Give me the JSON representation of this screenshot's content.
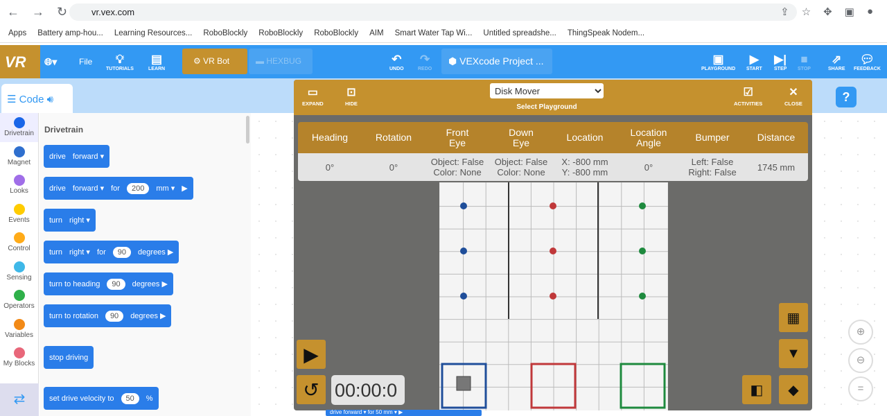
{
  "browser": {
    "url": "vr.vex.com",
    "bookmarks": [
      "Apps",
      "Battery amp-hou...",
      "Learning Resources...",
      "RoboBlockly",
      "RoboBlockly",
      "RoboBlockly",
      "AIM",
      "Smart Water Tap Wi...",
      "Untitled spreadshe...",
      "ThingSpeak Nodem..."
    ]
  },
  "toolbar": {
    "logo": "VR",
    "file": "File",
    "tutorials": "TUTORIALS",
    "learn": "LEARN",
    "vr_bot": "VR Bot",
    "hexbug": "HEXBUG",
    "undo": "UNDO",
    "redo": "REDO",
    "project": "VEXcode Project ...",
    "playground": "PLAYGROUND",
    "start": "START",
    "step": "STEP",
    "stop": "STOP",
    "share": "SHARE",
    "feedback": "FEEDBACK"
  },
  "code_tab": "Code",
  "categories": [
    {
      "label": "Drivetrain",
      "color": "#1a66e8"
    },
    {
      "label": "Magnet",
      "color": "#2f6fce"
    },
    {
      "label": "Looks",
      "color": "#a06ee8"
    },
    {
      "label": "Events",
      "color": "#ffcc00"
    },
    {
      "label": "Control",
      "color": "#ffab19"
    },
    {
      "label": "Sensing",
      "color": "#3fb8e8"
    },
    {
      "label": "Operators",
      "color": "#2fb04a"
    },
    {
      "label": "Variables",
      "color": "#f28a17"
    },
    {
      "label": "My Blocks",
      "color": "#e8677a"
    }
  ],
  "palette": {
    "title": "Drivetrain",
    "blocks": [
      {
        "parts": [
          "drive",
          "forward ▾"
        ]
      },
      {
        "parts": [
          "drive",
          "forward ▾",
          "for"
        ],
        "value": "200",
        "after": [
          "mm ▾",
          "▶"
        ]
      },
      {
        "parts": [
          "turn",
          "right ▾"
        ]
      },
      {
        "parts": [
          "turn",
          "right ▾",
          "for"
        ],
        "value": "90",
        "after": [
          "degrees ▶"
        ]
      },
      {
        "parts": [
          "turn to heading"
        ],
        "value": "90",
        "after": [
          "degrees ▶"
        ]
      },
      {
        "parts": [
          "turn to rotation"
        ],
        "value": "90",
        "after": [
          "degrees ▶"
        ]
      },
      {
        "parts": [
          "stop driving"
        ]
      },
      {
        "parts": [
          "set drive velocity to"
        ],
        "value": "50",
        "after": [
          "%"
        ]
      }
    ]
  },
  "ghost_block": "drive  forward ▾  for  50  mm ▾  ▶",
  "playground": {
    "expand": "EXPAND",
    "hide": "HIDE",
    "selected": "Disk Mover",
    "select_label": "Select Playground",
    "activities": "ACTIVITIES",
    "close": "CLOSE",
    "headers": [
      "Heading",
      "Rotation",
      "Front\nEye",
      "Down\nEye",
      "Location",
      "Location\nAngle",
      "Bumper",
      "Distance"
    ],
    "values": [
      "0°",
      "0°",
      "Object: False\nColor: None",
      "Object: False\nColor: None",
      "X: -800 mm\nY: -800 mm",
      "0°",
      "Left: False\nRight: False",
      "1745 mm"
    ],
    "timer": "00:00:0",
    "disk_colors": [
      "#1f4e9a",
      "#c0383a",
      "#1e8a3e"
    ],
    "goal_colors": [
      "#1f4e9a",
      "#c0383a",
      "#1e8a3e"
    ]
  }
}
